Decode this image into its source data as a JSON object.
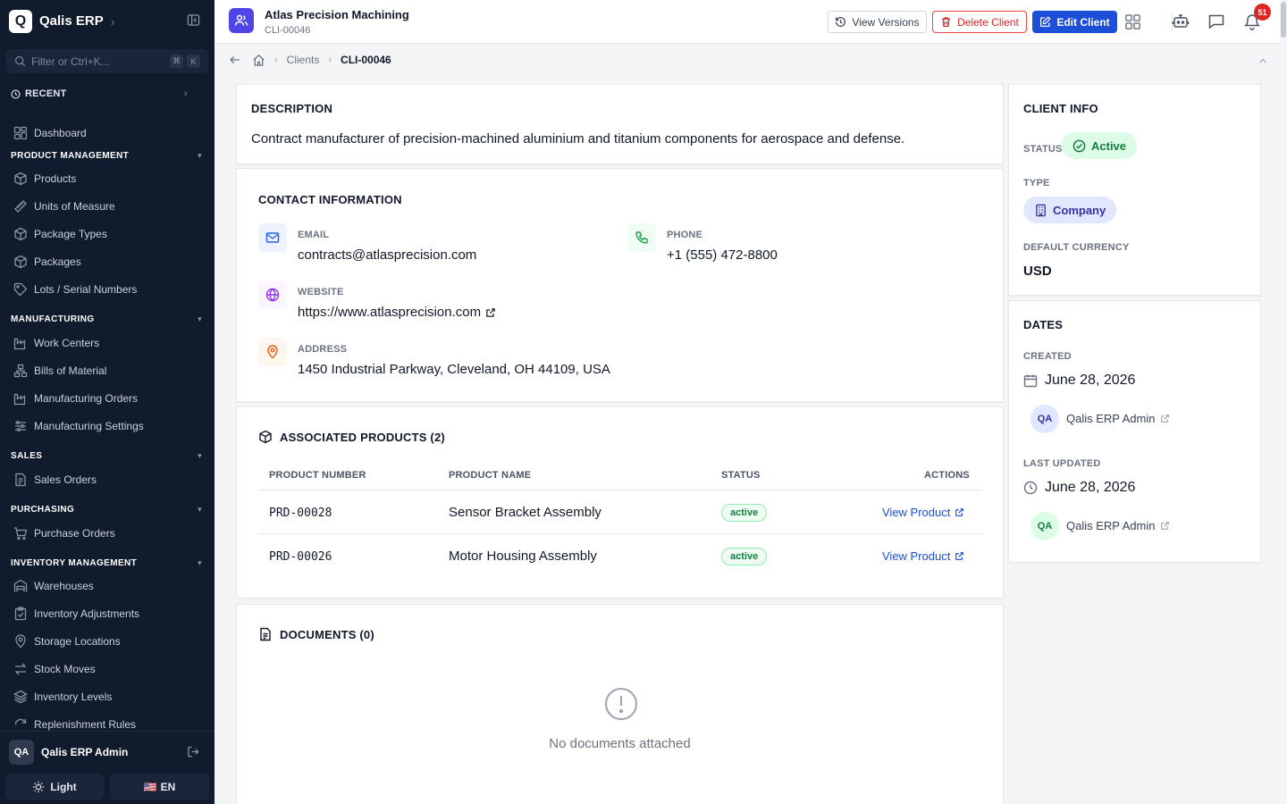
{
  "app": {
    "name": "Qalis ERP",
    "logo_letter": "Q"
  },
  "sidebar": {
    "filter_placeholder": "Filter or Ctrl+K...",
    "kbd_cmd": "⌘",
    "kbd_k": "K",
    "recent_label": "RECENT",
    "dashboard": "Dashboard",
    "sections": [
      {
        "title": "PRODUCT MANAGEMENT",
        "items": [
          "Products",
          "Units of Measure",
          "Package Types",
          "Packages",
          "Lots / Serial Numbers"
        ]
      },
      {
        "title": "MANUFACTURING",
        "items": [
          "Work Centers",
          "Bills of Material",
          "Manufacturing Orders",
          "Manufacturing Settings"
        ]
      },
      {
        "title": "SALES",
        "items": [
          "Sales Orders"
        ]
      },
      {
        "title": "PURCHASING",
        "items": [
          "Purchase Orders"
        ]
      },
      {
        "title": "INVENTORY MANAGEMENT",
        "items": [
          "Warehouses",
          "Inventory Adjustments",
          "Storage Locations",
          "Stock Moves",
          "Inventory Levels",
          "Replenishment Rules"
        ]
      }
    ],
    "user": {
      "initials": "QA",
      "name": "Qalis ERP Admin"
    },
    "theme_label": "Light",
    "lang_flag": "🇺🇸",
    "lang_label": "EN"
  },
  "header": {
    "title": "Atlas Precision Machining",
    "code": "CLI-00046",
    "view_versions": "View Versions",
    "delete_client": "Delete Client",
    "edit_client": "Edit Client",
    "notification_count": "51"
  },
  "breadcrumb": {
    "clients": "Clients",
    "current": "CLI-00046"
  },
  "description": {
    "title": "DESCRIPTION",
    "text": "Contract manufacturer of precision-machined aluminium and titanium components for aerospace and defense."
  },
  "contact": {
    "title": "CONTACT INFORMATION",
    "email_label": "EMAIL",
    "email": "contracts@atlasprecision.com",
    "phone_label": "PHONE",
    "phone": "+1 (555) 472-8800",
    "website_label": "WEBSITE",
    "website": "https://www.atlasprecision.com",
    "address_label": "ADDRESS",
    "address": "1450 Industrial Parkway, Cleveland, OH 44109, USA"
  },
  "products": {
    "title": "ASSOCIATED PRODUCTS (2)",
    "columns": [
      "PRODUCT NUMBER",
      "PRODUCT NAME",
      "STATUS",
      "ACTIONS"
    ],
    "rows": [
      {
        "number": "PRD-00028",
        "name": "Sensor Bracket Assembly",
        "status": "active",
        "action": "View Product"
      },
      {
        "number": "PRD-00026",
        "name": "Motor Housing Assembly",
        "status": "active",
        "action": "View Product"
      }
    ]
  },
  "documents": {
    "title": "DOCUMENTS (0)",
    "empty": "No documents attached"
  },
  "client_info": {
    "title": "CLIENT INFO",
    "status_label": "STATUS",
    "status": "Active",
    "type_label": "TYPE",
    "type": "Company",
    "currency_label": "DEFAULT CURRENCY",
    "currency": "USD"
  },
  "dates": {
    "title": "DATES",
    "created_label": "CREATED",
    "created": "June 28, 2026",
    "created_by": {
      "initials": "QA",
      "name": "Qalis ERP Admin"
    },
    "updated_label": "LAST UPDATED",
    "updated": "June 28, 2026",
    "updated_by": {
      "initials": "QA",
      "name": "Qalis ERP Admin"
    }
  },
  "colors": {
    "sidebar_bg": "#111b2e",
    "primary": "#1d4ed8",
    "danger": "#dc2626",
    "success": "#16a34a",
    "accent": "#4f46e5"
  }
}
